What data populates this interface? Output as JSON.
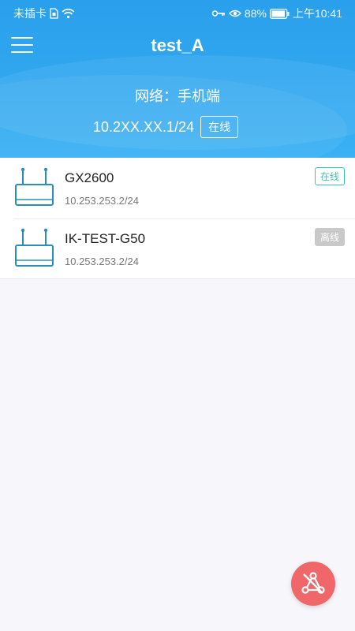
{
  "status_bar": {
    "carrier": "未插卡",
    "battery": "88%",
    "time": "上午10:41"
  },
  "header": {
    "title": "test_A",
    "network_label": "网络：手机端",
    "ip": "10.2XX.XX.1/24",
    "status": "在线"
  },
  "devices": [
    {
      "name": "GX2600",
      "ip": "10.253.253.2/24",
      "status": "在线"
    },
    {
      "name": "IK-TEST-G50",
      "ip": "10.253.253.2/24",
      "status": "离线"
    }
  ],
  "colors": {
    "header_blue": "#2aa0ec",
    "online": "#3cc0b7",
    "offline": "#c9c9c9",
    "fab": "#f0676a"
  },
  "icons": {
    "menu": "menu-icon",
    "router": "router-icon",
    "fab": "network-topology-icon"
  }
}
